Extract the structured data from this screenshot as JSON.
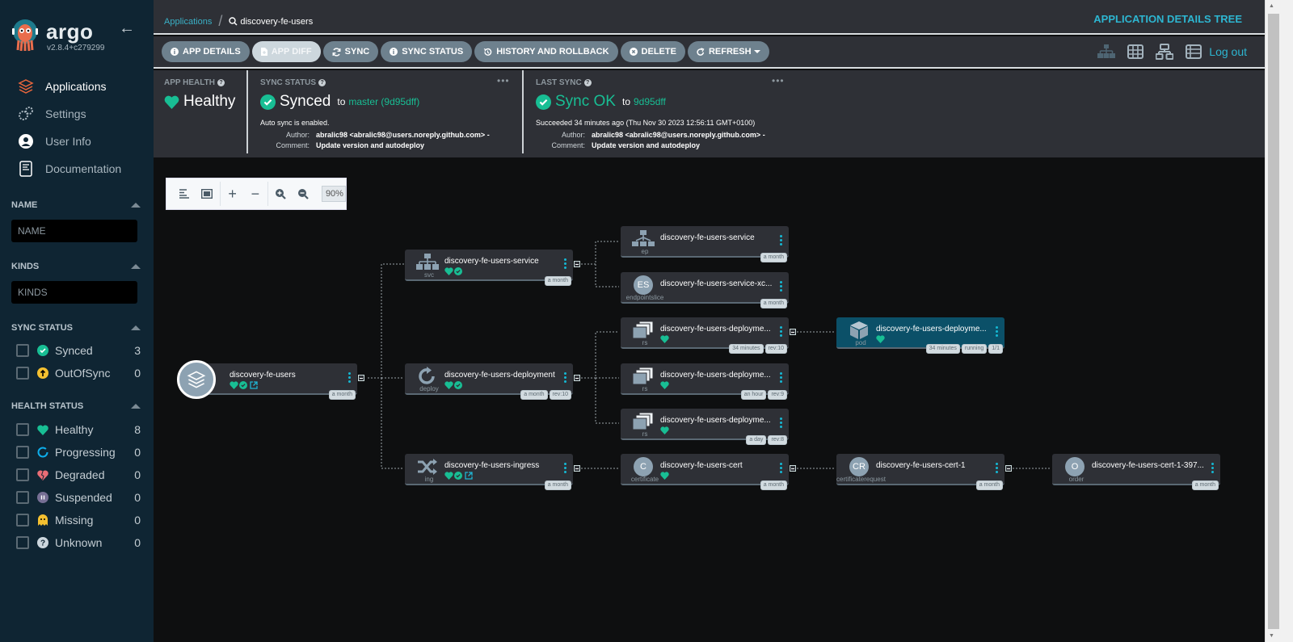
{
  "sidebar": {
    "brand": "argo",
    "version": "v2.8.4+c279299",
    "nav": [
      {
        "label": "Applications",
        "icon": "layers-icon",
        "active": true
      },
      {
        "label": "Settings",
        "icon": "gears-icon"
      },
      {
        "label": "User Info",
        "icon": "user-circle-icon"
      },
      {
        "label": "Documentation",
        "icon": "book-icon"
      }
    ],
    "filters": {
      "name": {
        "title": "NAME",
        "placeholder": "NAME"
      },
      "kinds": {
        "title": "KINDS",
        "placeholder": "KINDS"
      },
      "sync_status": {
        "title": "SYNC STATUS",
        "items": [
          {
            "label": "Synced",
            "count": "3",
            "color": "#18be94"
          },
          {
            "label": "OutOfSync",
            "count": "0",
            "color": "#f4c030"
          }
        ]
      },
      "health_status": {
        "title": "HEALTH STATUS",
        "items": [
          {
            "label": "Healthy",
            "count": "8",
            "color": "#18be94"
          },
          {
            "label": "Progressing",
            "count": "0",
            "color": "#0dadea"
          },
          {
            "label": "Degraded",
            "count": "0",
            "color": "#e96d76"
          },
          {
            "label": "Suspended",
            "count": "0",
            "color": "#766f94"
          },
          {
            "label": "Missing",
            "count": "0",
            "color": "#f4c030"
          },
          {
            "label": "Unknown",
            "count": "0",
            "color": "#ccd6dd"
          }
        ]
      }
    }
  },
  "breadcrumb": {
    "root": "Applications",
    "current": "discovery-fe-users"
  },
  "page_title": "APPLICATION DETAILS TREE",
  "toolbar": {
    "buttons": [
      {
        "label": "APP DETAILS",
        "icon": "info-icon"
      },
      {
        "label": "APP DIFF",
        "icon": "file-diff-icon",
        "disabled": true
      },
      {
        "label": "SYNC",
        "icon": "sync-icon"
      },
      {
        "label": "SYNC STATUS",
        "icon": "info-icon"
      },
      {
        "label": "HISTORY AND ROLLBACK",
        "icon": "history-icon"
      },
      {
        "label": "DELETE",
        "icon": "times-circle-icon"
      },
      {
        "label": "REFRESH",
        "icon": "redo-icon",
        "dropdown": true
      }
    ],
    "logout": "Log out"
  },
  "status": {
    "app_health": {
      "title": "APP HEALTH",
      "value": "Healthy"
    },
    "sync_status": {
      "title": "SYNC STATUS",
      "value": "Synced",
      "to": "to",
      "target": "master (9d95dff)",
      "note": "Auto sync is enabled.",
      "author_label": "Author:",
      "author": "abralic98 <abralic98@users.noreply.github.com> -",
      "comment_label": "Comment:",
      "comment": "Update version and autodeploy"
    },
    "last_sync": {
      "title": "LAST SYNC",
      "value": "Sync OK",
      "to": "to",
      "target": "9d95dff",
      "note": "Succeeded 34 minutes ago (Thu Nov 30 2023 12:56:11 GMT+0100)",
      "author_label": "Author:",
      "author": "abralic98 <abralic98@users.noreply.github.com> -",
      "comment_label": "Comment:",
      "comment": "Update version and autodeploy"
    }
  },
  "zoom": {
    "level": "90%"
  },
  "tree": {
    "root": {
      "name": "discovery-fe-users",
      "tags": [
        "a month"
      ]
    },
    "nodes": [
      {
        "id": "svc",
        "kind": "svc",
        "name": "discovery-fe-users-service",
        "tags": [
          "a month"
        ],
        "status": [
          "heart",
          "check"
        ]
      },
      {
        "id": "deploy",
        "kind": "deploy",
        "name": "discovery-fe-users-deployment",
        "tags": [
          "a month",
          "rev:10"
        ],
        "status": [
          "heart",
          "check"
        ]
      },
      {
        "id": "ing",
        "kind": "ing",
        "name": "discovery-fe-users-ingress",
        "tags": [
          "a month"
        ],
        "status": [
          "heart",
          "check",
          "link"
        ]
      },
      {
        "id": "ep",
        "kind": "ep",
        "name": "discovery-fe-users-service",
        "tags": [
          "a month"
        ],
        "status": []
      },
      {
        "id": "es",
        "kind": "endpointslice",
        "abbr": "ES",
        "name": "discovery-fe-users-service-xc...",
        "tags": [
          "a month"
        ],
        "status": []
      },
      {
        "id": "rs1",
        "kind": "rs",
        "name": "discovery-fe-users-deployme...",
        "tags": [
          "34 minutes",
          "rev:10"
        ],
        "status": [
          "heart"
        ]
      },
      {
        "id": "rs2",
        "kind": "rs",
        "name": "discovery-fe-users-deployme...",
        "tags": [
          "an hour",
          "rev:9"
        ],
        "status": [
          "heart"
        ]
      },
      {
        "id": "rs3",
        "kind": "rs",
        "name": "discovery-fe-users-deployme...",
        "tags": [
          "a day",
          "rev:8"
        ],
        "status": [
          "heart"
        ]
      },
      {
        "id": "cert",
        "kind": "certificate",
        "abbr": "C",
        "name": "discovery-fe-users-cert",
        "tags": [
          "a month"
        ],
        "status": [
          "heart"
        ]
      },
      {
        "id": "pod",
        "kind": "pod",
        "name": "discovery-fe-users-deployme...",
        "tags": [
          "34 minutes",
          "running",
          "1/1"
        ],
        "status": [
          "heart"
        ]
      },
      {
        "id": "cr",
        "kind": "certificaterequest",
        "abbr": "CR",
        "name": "discovery-fe-users-cert-1",
        "tags": [
          "a month"
        ],
        "status": []
      },
      {
        "id": "order",
        "kind": "order",
        "abbr": "O",
        "name": "discovery-fe-users-cert-1-397...",
        "tags": [
          "a month"
        ],
        "status": []
      }
    ]
  }
}
